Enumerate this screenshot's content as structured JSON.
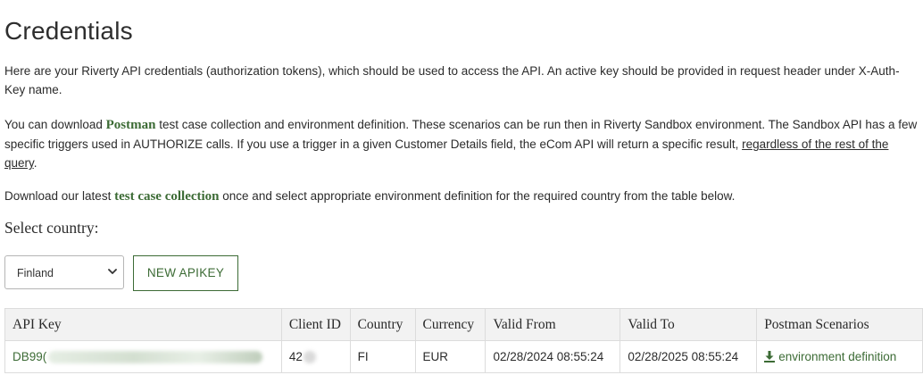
{
  "page": {
    "title": "Credentials"
  },
  "intro": {
    "p1": "Here are your Riverty API credentials (authorization tokens), which should be used to access the API. An active key should be provided in request header under X-Auth-Key name.",
    "p2_before": "You can download ",
    "p2_link": "Postman",
    "p2_middle": " test case collection and environment definition. These scenarios can be run then in Riverty Sandbox environment. The Sandbox API has a few specific triggers used in AUTHORIZE calls. If you use a trigger in a given Customer Details field, the eCom API will return a specific result, ",
    "p2_underline": "regardless of the rest of the query",
    "p2_end": ".",
    "p3_before": "Download our latest ",
    "p3_link": "test case collection",
    "p3_after": " once and select appropriate environment definition for the required country from the table below."
  },
  "controls": {
    "select_label": "Select country:",
    "country_selected": "Finland",
    "new_apikey_label": "NEW APIKEY"
  },
  "table": {
    "headers": [
      "API Key",
      "Client ID",
      "Country",
      "Currency",
      "Valid From",
      "Valid To",
      "Postman Scenarios"
    ],
    "rows": [
      {
        "api_key_visible": "DB99(",
        "client_id_visible": "42",
        "country": "FI",
        "currency": "EUR",
        "valid_from": "02/28/2024 08:55:24",
        "valid_to": "02/28/2025 08:55:24",
        "postman_link": "environment definition"
      }
    ]
  },
  "icons": {
    "download": "download-icon",
    "dropdown": "chevron-down-icon"
  },
  "colors": {
    "accent_green": "#3c6b35",
    "header_bg": "#f2f2f2",
    "border": "#dcdcdc"
  }
}
